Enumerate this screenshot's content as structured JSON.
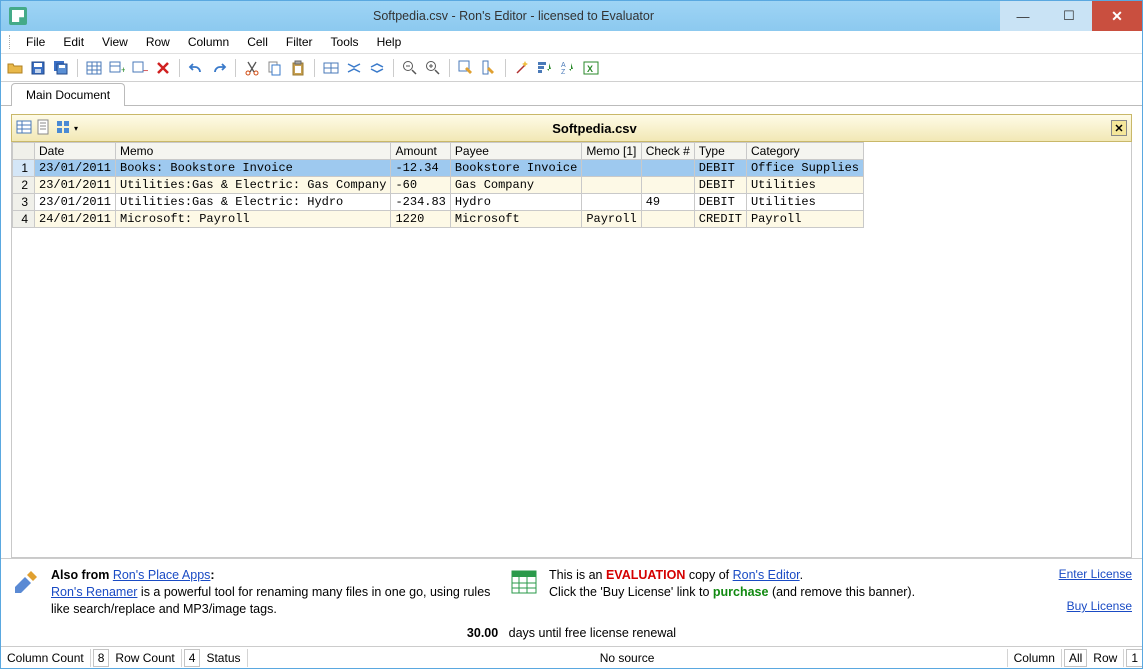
{
  "window": {
    "title": "Softpedia.csv - Ron's Editor - licensed to Evaluator"
  },
  "menu": {
    "items": [
      "File",
      "Edit",
      "View",
      "Row",
      "Column",
      "Cell",
      "Filter",
      "Tools",
      "Help"
    ]
  },
  "tabs": {
    "main": "Main Document"
  },
  "doc": {
    "title": "Softpedia.csv"
  },
  "grid": {
    "columns": [
      "Date",
      "Memo",
      "Amount",
      "Payee",
      "Memo [1]",
      "Check #",
      "Type",
      "Category"
    ],
    "rows": [
      {
        "n": "1",
        "Date": "23/01/2011",
        "Memo": "Books: Bookstore Invoice",
        "Amount": "-12.34",
        "Payee": "Bookstore Invoice",
        "Memo1": "",
        "Check": "",
        "Type": "DEBIT",
        "Category": "Office Supplies",
        "selected": true
      },
      {
        "n": "2",
        "Date": "23/01/2011",
        "Memo": "Utilities:Gas & Electric: Gas Company",
        "Amount": "-60",
        "Payee": "Gas Company",
        "Memo1": "",
        "Check": "",
        "Type": "DEBIT",
        "Category": "Utilities"
      },
      {
        "n": "3",
        "Date": "23/01/2011",
        "Memo": "Utilities:Gas & Electric: Hydro",
        "Amount": "-234.83",
        "Payee": "Hydro",
        "Memo1": "",
        "Check": "49",
        "Type": "DEBIT",
        "Category": "Utilities"
      },
      {
        "n": "4",
        "Date": "24/01/2011",
        "Memo": "Microsoft: Payroll",
        "Amount": "1220",
        "Payee": "Microsoft",
        "Memo1": "Payroll",
        "Check": "",
        "Type": "CREDIT",
        "Category": "Payroll"
      }
    ]
  },
  "banner": {
    "also_from_label": "Also from",
    "rons_place_apps": "Ron's Place Apps",
    "rons_renamer": "Ron's Renamer",
    "renamer_text": " is a powerful tool for renaming many files in one go, using rules like search/replace and MP3/image tags.",
    "eval_text1": "This is an ",
    "eval_word": "EVALUATION",
    "eval_text2": " copy of ",
    "rons_editor": "Ron's Editor",
    "buy_text1": "Click the 'Buy License' link to ",
    "purchase": "purchase",
    "buy_text2": " (and remove this banner).",
    "enter_license": "Enter License",
    "buy_license": "Buy License",
    "days": "30.00",
    "days_text": "days until free license renewal"
  },
  "status": {
    "col_count_label": "Column Count",
    "col_count": "8",
    "row_count_label": "Row Count",
    "row_count": "4",
    "status_label": "Status",
    "no_source": "No source",
    "column_label": "Column",
    "column_val": "All",
    "row_label": "Row",
    "row_val": "1"
  }
}
